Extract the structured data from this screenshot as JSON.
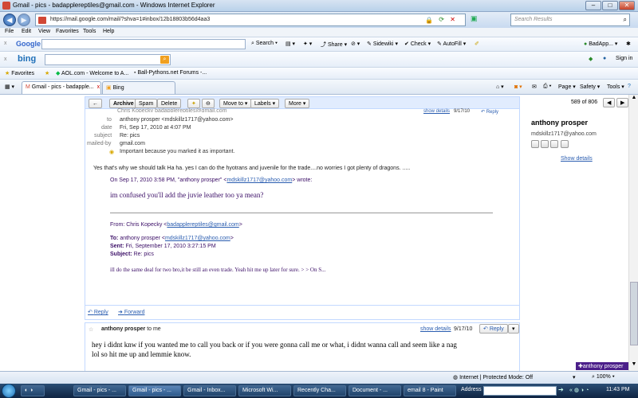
{
  "window": {
    "title": "Gmail - pics - badapplereptiles@gmail.com - Windows Internet Explorer",
    "min": "–",
    "max": "□",
    "close": "✕"
  },
  "address": {
    "url": "https://mail.google.com/mail/?shva=1#inbox/12b18803b56d4aa3",
    "search_placeholder": "Search Results"
  },
  "menu": [
    "File",
    "Edit",
    "View",
    "Favorites",
    "Tools",
    "Help"
  ],
  "google_toolbar": {
    "logo": "Google",
    "search": "Search",
    "share": "Share",
    "sidewiki": "Sidewiki",
    "check": "Check",
    "autofill": "AutoFill",
    "account": "BadApp...",
    "close": "x"
  },
  "bing_toolbar": {
    "logo": "bing",
    "signin": "Sign in",
    "close": "x"
  },
  "favorites": {
    "label": "Favorites",
    "items": [
      "AOL.com - Welcome to A...",
      "Ball-Pythons.net Forums -..."
    ]
  },
  "tabs": [
    {
      "label": "Gmail - pics - badapple...",
      "close": "x"
    },
    {
      "label": "Bing"
    }
  ],
  "cmdbar": {
    "page": "Page",
    "safety": "Safety",
    "tools": "Tools"
  },
  "gmail_toolbar": {
    "back": "←",
    "archive": "Archive",
    "spam": "Spam",
    "delete": "Delete",
    "move": "Move to",
    "labels": "Labels",
    "more": "More",
    "pager": "589 of 806"
  },
  "message1": {
    "partial_header": "Chris Kopecky badapplereptiles@gmail.com",
    "to_label": "to",
    "to": "anthony prosper <mdskillz1717@yahoo.com>",
    "date_label": "date",
    "date": "Fri, Sep 17, 2010 at 4:07 PM",
    "subject_label": "subject",
    "subject": "Re: pics",
    "mailedby_label": "mailed-by",
    "mailedby": "gmail.com",
    "important": "Important because you marked it as important.",
    "body": "Yes that's why we should talk Ha ha.  yes I can do the hyotrans and juvenile for the trade....no worries I got plenty of dragons. .....",
    "quote_intro": "On Sep 17, 2010 3:58 PM, \"anthony prosper\" <",
    "quote_email": "mdskillz1717@yahoo.com",
    "quote_intro_end": "> wrote:",
    "quote_text": "im confused you'll add the juvie leather too ya mean?",
    "fwd_from_label": "From: Chris Kopecky <",
    "fwd_from_email": "badapplereptiles@gmail.com",
    "fwd_from_end": ">",
    "fwd_to_label": "To:",
    "fwd_to": "anthony prosper <",
    "fwd_to_email": "mdskillz1717@yahoo.com",
    "fwd_to_end": ">",
    "fwd_sent_label": "Sent:",
    "fwd_sent": "Fri, September 17, 2010 3:27:15 PM",
    "fwd_subject_label": "Subject:",
    "fwd_subject": "Re: pics",
    "fwd_body": "ill do the same deal for two bro,it be still an even trade. Yeah hit me up later for sure. > > On S...",
    "reply": "Reply",
    "forward": "Forward"
  },
  "message2": {
    "sender": "anthony prosper",
    "to_me": "to me",
    "show_details": "show details",
    "date": "9/17/10",
    "reply": "Reply",
    "body_line1": "hey i didnt knw if you wanted me to call you back or if you were gonna call me or what, i didnt wanna call and seem like a nag",
    "body_line2": "lol so hit me up and lemmie know."
  },
  "top_partial": {
    "show_details": "show details",
    "date": "9/17/10",
    "reply": "Reply"
  },
  "contact": {
    "name": "anthony prosper",
    "email": "mdskillz1717@yahoo.com",
    "show_details": "Show details",
    "chat_badge": "anthony prosper"
  },
  "statusbar": {
    "zone": "Internet | Protected Mode: Off",
    "zoom": "100%"
  },
  "taskbar": {
    "items": [
      "Gmail - pics - ...",
      "Gmail - pics - ...",
      "Gmail - Inbox...",
      "Microsoft Wi...",
      "Recently Cha...",
      "Document - ...",
      "email 8 - Paint"
    ],
    "address_label": "Address",
    "time": "11:43 PM"
  },
  "colors": {
    "gmail_blue": "#c3d9ff",
    "quote_purple": "#3a0d66",
    "link": "#2a5db0"
  }
}
